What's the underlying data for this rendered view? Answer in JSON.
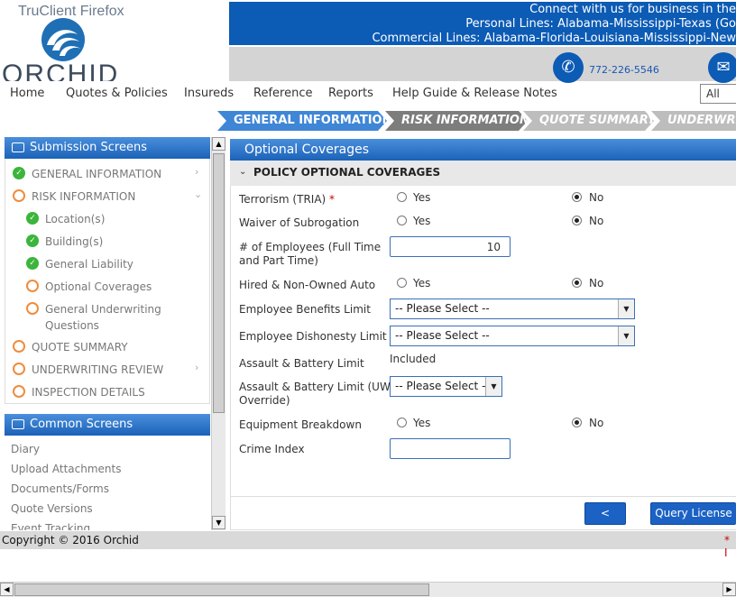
{
  "browser_title": "TruClient Firefox",
  "logo_text": "ORCHID",
  "banner": {
    "line1": "Connect with us for business in the",
    "line2": "Personal Lines: Alabama-Mississippi-Texas (Go",
    "line3": "Commercial Lines: Alabama-Florida-Louisiana-Mississippi-New"
  },
  "contact": {
    "phone": "772-226-5546"
  },
  "nav": {
    "items": [
      "Home",
      "Quotes & Policies",
      "Insureds",
      "Reference",
      "Reports",
      "Help Guide & Release Notes"
    ],
    "select_value": "All"
  },
  "steps": [
    "GENERAL INFORMATION",
    "RISK INFORMATION",
    "QUOTE SUMMARY",
    "UNDERWRITI"
  ],
  "submission": {
    "title": "Submission Screens",
    "items": [
      "GENERAL INFORMATION",
      "RISK INFORMATION",
      "Location(s)",
      "Building(s)",
      "General Liability",
      "Optional Coverages",
      "General Underwriting",
      "Questions",
      "QUOTE SUMMARY",
      "UNDERWRITING REVIEW",
      "INSPECTION DETAILS"
    ]
  },
  "common": {
    "title": "Common Screens",
    "items": [
      "Diary",
      "Upload Attachments",
      "Documents/Forms",
      "Quote Versions",
      "Event Tracking"
    ]
  },
  "main": {
    "title": "Optional Coverages",
    "section": "POLICY OPTIONAL COVERAGES",
    "yes": "Yes",
    "no": "No",
    "required_mark": "*",
    "fields": {
      "terrorism": "Terrorism (TRIA)",
      "waiver": "Waiver of Subrogation",
      "employees_1": "# of Employees (Full Time",
      "employees_2": "and Part Time)",
      "employees_value": "10",
      "hired": "Hired & Non-Owned Auto",
      "benefits": "Employee Benefits Limit",
      "dishonesty": "Employee Dishonesty Limit",
      "assault": "Assault & Battery Limit",
      "assault_value": "Included",
      "assault_uw_1": "Assault & Battery Limit (UW",
      "assault_uw_2": "Override)",
      "equipment": "Equipment Breakdown",
      "crime": "Crime Index",
      "please_select": "-- Please Select --"
    },
    "btn_back": "<",
    "btn_query": "Query License"
  },
  "footer": {
    "copyright": "Copyright © 2016 Orchid",
    "right_mark": "* I"
  }
}
